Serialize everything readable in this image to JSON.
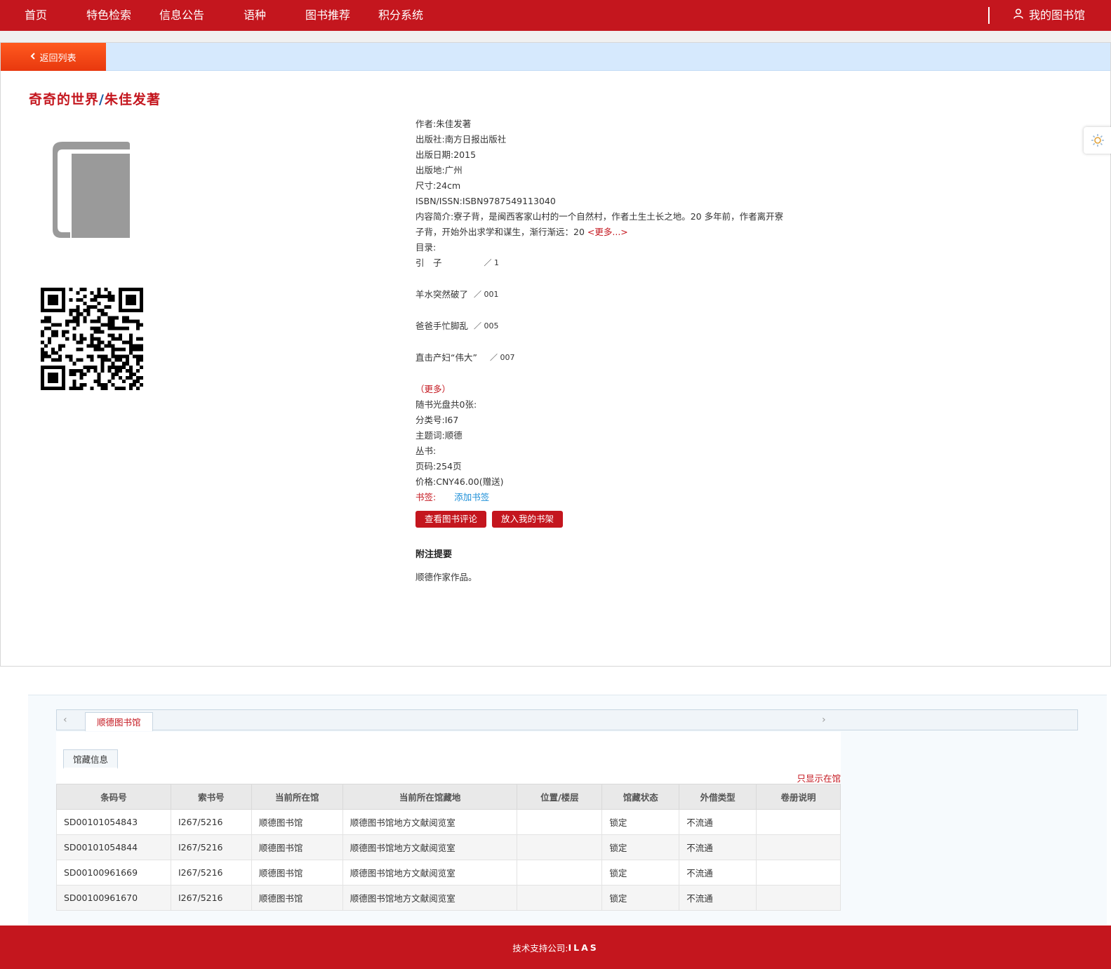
{
  "nav": {
    "items": [
      "首页",
      "特色检索",
      "信息公告",
      "语种",
      "图书推荐",
      "积分系统"
    ],
    "my_library": "我的图书馆"
  },
  "back": {
    "label": "返回列表"
  },
  "book": {
    "title": "奇奇的世界",
    "slash": "/",
    "responsibility": "朱佳发著",
    "fields": [
      {
        "label": "作者:",
        "value": "朱佳发著"
      },
      {
        "label": "出版社:",
        "value": "南方日报出版社"
      },
      {
        "label": "出版日期:",
        "value": "2015"
      },
      {
        "label": "出版地:",
        "value": "广州"
      },
      {
        "label": "尺寸:",
        "value": "24cm"
      },
      {
        "label": "ISBN/ISSN:",
        "value": "ISBN9787549113040"
      }
    ],
    "summary_label": "内容简介:",
    "summary": "寮子背，是闽西客家山村的一个自然村，作者土生土长之地。20 多年前，作者离开寮子背，开始外出求学和谋生，渐行渐远：20",
    "summary_more": "<更多...>",
    "toc_label": "目录:",
    "toc": [
      {
        "title": "引　子",
        "page": "／ 1",
        "pad": "60px"
      },
      {
        "title": "羊水突然破了",
        "page": "／ 001",
        "pad": "8px"
      },
      {
        "title": "爸爸手忙脚乱",
        "page": "／ 005",
        "pad": "8px"
      },
      {
        "title": "直击产妇“伟大”",
        "page": "／ 007",
        "pad": "18px"
      }
    ],
    "toc_more_open": "（",
    "toc_more": "更多",
    "toc_more_close": "）",
    "fields2": [
      {
        "label": "随书光盘共0张:",
        "value": ""
      },
      {
        "label": "分类号:",
        "value": "I67"
      },
      {
        "label": "主题词:",
        "value": "顺德"
      },
      {
        "label": "丛书:",
        "value": ""
      },
      {
        "label": "页码:",
        "value": "254页"
      },
      {
        "label": "价格:",
        "value": "CNY46.00(赠送)"
      }
    ],
    "bookmark_label": "书签:",
    "bookmark_add": "添加书签",
    "btn_review": "查看图书评论",
    "btn_shelf": "放入我的书架",
    "note_head": "附注提要",
    "note_body": "顺德作家作品。"
  },
  "holdings": {
    "library_tab": "顺德图书馆",
    "sub_tab": "馆藏信息",
    "only_in_library": "只显示在馆",
    "columns": [
      "条码号",
      "索书号",
      "当前所在馆",
      "当前所在馆藏地",
      "位置/楼层",
      "馆藏状态",
      "外借类型",
      "卷册说明"
    ],
    "rows": [
      [
        "SD00101054843",
        "I267/5216",
        "顺德图书馆",
        "顺德图书馆地方文献阅览室",
        "",
        "锁定",
        "不流通",
        ""
      ],
      [
        "SD00101054844",
        "I267/5216",
        "顺德图书馆",
        "顺德图书馆地方文献阅览室",
        "",
        "锁定",
        "不流通",
        ""
      ],
      [
        "SD00100961669",
        "I267/5216",
        "顺德图书馆",
        "顺德图书馆地方文献阅览室",
        "",
        "锁定",
        "不流通",
        ""
      ],
      [
        "SD00100961670",
        "I267/5216",
        "顺德图书馆",
        "顺德图书馆地方文献阅览室",
        "",
        "锁定",
        "不流通",
        ""
      ]
    ]
  },
  "footer": {
    "label": "技术支持公司:",
    "company": "ILAS"
  },
  "colors": {
    "brand": "#c4161e",
    "back_button": "#f04a15",
    "link_blue": "#1c8fd8"
  },
  "icons": [
    "chevron-left-icon",
    "user-icon",
    "book-cover-icon",
    "qr-code-icon",
    "settings-icon",
    "arrow-left-icon",
    "arrow-right-icon"
  ]
}
